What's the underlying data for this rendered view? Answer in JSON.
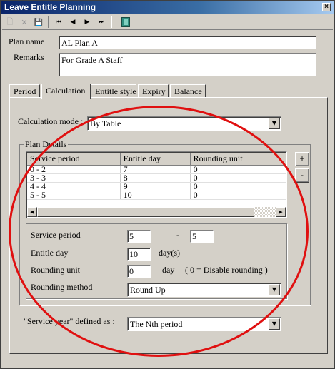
{
  "window": {
    "title": "Leave Entitle Planning",
    "close_glyph": "×"
  },
  "toolbar": {
    "buttons": [
      {
        "name": "new-icon",
        "glyph": "🗋"
      },
      {
        "name": "delete-icon",
        "glyph": "✕"
      },
      {
        "name": "save-icon",
        "glyph": "💾"
      },
      {
        "name": "first-record-icon",
        "glyph": "⏮"
      },
      {
        "name": "previous-record-icon",
        "glyph": "◀"
      },
      {
        "name": "next-record-icon",
        "glyph": "▶"
      },
      {
        "name": "last-record-icon",
        "glyph": "⏭"
      },
      {
        "name": "exit-icon",
        "glyph": "🚪"
      }
    ]
  },
  "plan": {
    "name_label": "Plan name",
    "name_value": "AL Plan A",
    "remarks_label": "Remarks",
    "remarks_value": "For Grade A Staff"
  },
  "tabs": [
    "Period",
    "Calculation",
    "Entitle style",
    "Expiry",
    "Balance"
  ],
  "active_tab": "Calculation",
  "calculation": {
    "mode_label": "Calculation mode :",
    "mode_value": "By Table",
    "plan_details_title": "Plan Details",
    "grid": {
      "columns": [
        "Service period",
        "Entitle day",
        "Rounding unit",
        ""
      ],
      "rows": [
        [
          "0 - 2",
          "7",
          "0",
          ""
        ],
        [
          "3 - 3",
          "8",
          "0",
          ""
        ],
        [
          "4 - 4",
          "9",
          "0",
          ""
        ],
        [
          "5 - 5",
          "10",
          "0",
          ""
        ]
      ]
    },
    "add_button": "+",
    "remove_button": "-",
    "service_period_label": "Service period",
    "service_period_from": "5",
    "service_period_dash": "-",
    "service_period_to": "5",
    "entitle_day_label": "Entitle day",
    "entitle_day_value": "10",
    "entitle_day_unit": "day(s)",
    "rounding_unit_label": "Rounding unit",
    "rounding_unit_value": "0",
    "rounding_unit_unit": "day",
    "rounding_unit_hint": "( 0 = Disable rounding )",
    "rounding_method_label": "Rounding method",
    "rounding_method_value": "Round Up",
    "service_year_label": "\"Service year\" defined as :",
    "service_year_value": "The Nth period"
  },
  "colors": {
    "annotation": "#e01010",
    "titlebar": "#0a246a",
    "face": "#d4d0c8"
  }
}
